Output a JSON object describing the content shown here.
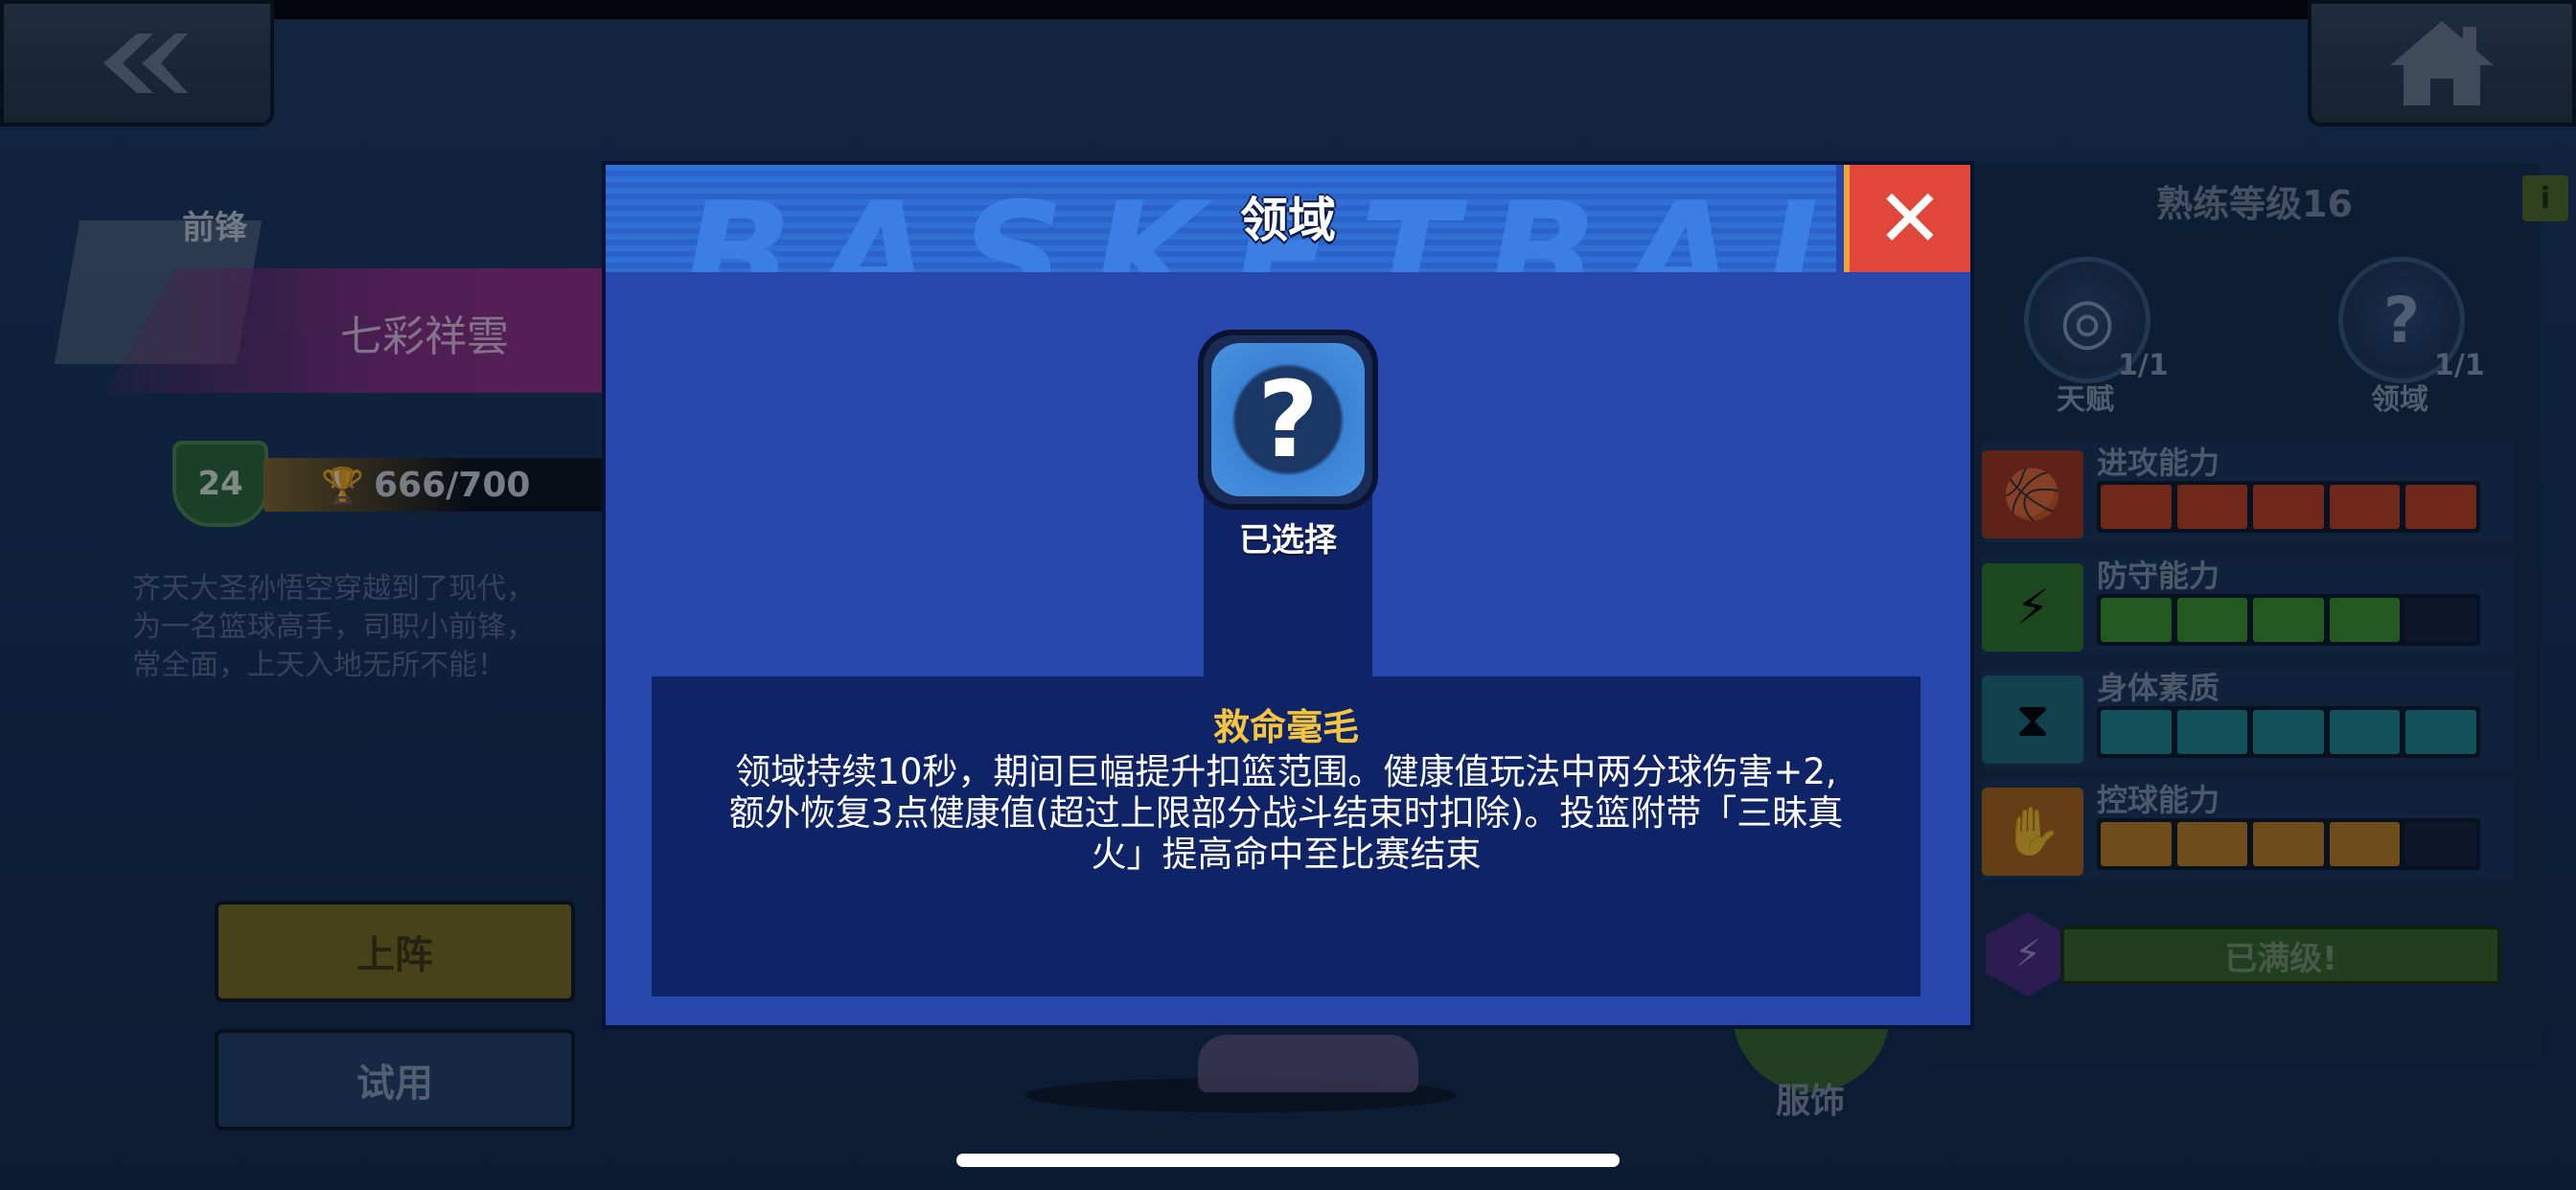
{
  "background": {
    "role_label": "前锋",
    "hero_name": "七彩祥雲",
    "trophy_level": "24",
    "trophy_progress": "666/700",
    "description_lines": [
      "齐天大圣孙悟空穿越到了现代，",
      "为一名篮球高手，司职小前锋，",
      "常全面，上天入地无所不能！"
    ],
    "deploy_button": "上阵",
    "trial_button": "试用",
    "outfit_label": "服饰",
    "mastery_title": "熟练等级16",
    "info_button": "i",
    "talent": {
      "label": "天赋",
      "count": "1/1"
    },
    "domain": {
      "label": "领域",
      "count": "1/1"
    },
    "stats": [
      {
        "label": "进攻能力",
        "filled": 5,
        "total": 5,
        "color": "#c9401f",
        "icon": "basketball-icon"
      },
      {
        "label": "防守能力",
        "filled": 4,
        "total": 5,
        "color": "#3a9a2a",
        "icon": "shield-bolt-icon"
      },
      {
        "label": "身体素质",
        "filled": 5,
        "total": 5,
        "color": "#1f8a92",
        "icon": "hourglass-icon"
      },
      {
        "label": "控球能力",
        "filled": 4,
        "total": 5,
        "color": "#c5821f",
        "icon": "hand-icon"
      }
    ],
    "maxed_label": "已满级!"
  },
  "modal": {
    "title": "领域",
    "close_icon": "close-icon",
    "header_watermark": "BASKETBALL",
    "skill_icon": "swirl-question-icon",
    "selected_label": "已选择",
    "skill_name": "救命毫毛",
    "skill_description_lines": [
      "领域持续10秒，期间巨幅提升扣篮范围。健康值玩法中两分球伤害+2,",
      "额外恢复3点健康值(超过上限部分战斗结束时扣除)。投篮附带「三昧真",
      "火」提高命中至比赛结束"
    ]
  }
}
